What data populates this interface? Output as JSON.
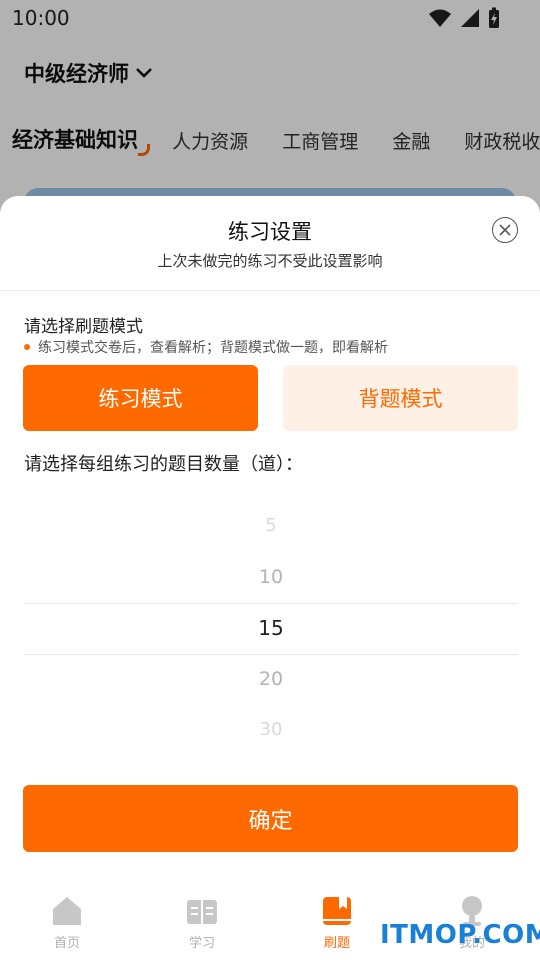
{
  "status_bar": {
    "time": "10:00"
  },
  "header": {
    "exam_title": "中级经济师"
  },
  "subject_tabs": [
    {
      "label": "经济基础知识",
      "active": true
    },
    {
      "label": "人力资源",
      "active": false
    },
    {
      "label": "工商管理",
      "active": false
    },
    {
      "label": "金融",
      "active": false
    },
    {
      "label": "财政税收",
      "active": false
    }
  ],
  "sheet": {
    "title": "练习设置",
    "subtitle": "上次未做完的练习不受此设置影响",
    "mode_label": "请选择刷题模式",
    "mode_hint": "练习模式交卷后，查看解析；背题模式做一题，即看解析",
    "modes": {
      "practice": "练习模式",
      "memorize": "背题模式",
      "selected": "practice"
    },
    "count_label": "请选择每组练习的题目数量（道）：",
    "count_options": [
      "5",
      "10",
      "15",
      "20",
      "30"
    ],
    "count_selected": "15",
    "confirm_label": "确定"
  },
  "bottom_nav": [
    {
      "label": "首页",
      "icon": "home-icon",
      "active": false
    },
    {
      "label": "学习",
      "icon": "book-open-icon",
      "active": false
    },
    {
      "label": "刷题",
      "icon": "question-book-icon",
      "active": true
    },
    {
      "label": "我的",
      "icon": "profile-icon",
      "active": false
    }
  ],
  "watermark": "ITMOP.COM",
  "colors": {
    "accent": "#ff6a00",
    "accent_light": "#fff0e6",
    "inactive_nav": "#b0b0b0"
  }
}
